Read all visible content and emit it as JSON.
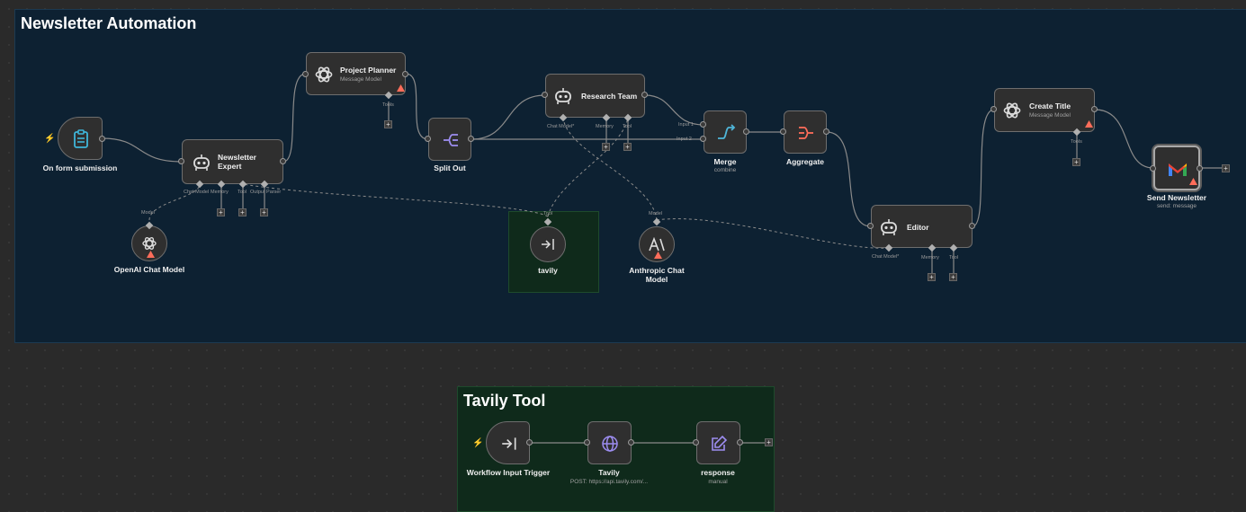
{
  "groups": {
    "newsletter": {
      "title": "Newsletter Automation"
    },
    "tavily_tool": {
      "title": "Tavily Tool"
    }
  },
  "nodes": {
    "form": {
      "label": "On form submission",
      "icon": "clipboard-icon"
    },
    "expert": {
      "label": "Newsletter Expert",
      "icon": "robot-icon"
    },
    "openai_model": {
      "label": "OpenAI Chat Model",
      "icon": "openai-icon"
    },
    "planner": {
      "label": "Project Planner",
      "subtitle": "Message Model",
      "icon": "openai-icon"
    },
    "split": {
      "label": "Split Out",
      "icon": "split-icon"
    },
    "research": {
      "label": "Research Team",
      "icon": "robot-icon"
    },
    "tavily_call": {
      "label": "tavily",
      "icon": "workflow-tool-icon"
    },
    "anthropic": {
      "label": "Anthropic Chat Model",
      "icon": "anthropic-icon"
    },
    "merge": {
      "label": "Merge",
      "subtitle": "combine",
      "icon": "merge-icon"
    },
    "aggregate": {
      "label": "Aggregate",
      "icon": "aggregate-icon"
    },
    "editor": {
      "label": "Editor",
      "icon": "robot-icon"
    },
    "create_title": {
      "label": "Create Title",
      "subtitle": "Message Model",
      "icon": "openai-icon"
    },
    "send": {
      "label": "Send Newsletter",
      "subtitle": "send: message",
      "icon": "gmail-icon"
    },
    "wf_trigger": {
      "label": "Workflow Input Trigger",
      "icon": "enter-icon"
    },
    "tavily_http": {
      "label": "Tavily",
      "subtitle": "POST: https://api.tavily.com/...",
      "icon": "globe-icon"
    },
    "response": {
      "label": "response",
      "subtitle": "manual",
      "icon": "edit-icon"
    }
  },
  "ports": {
    "expert_chat_model": "Chat Model",
    "expert_memory": "Memory",
    "expert_tool": "Tool",
    "expert_output_parser": "Output Parser",
    "openai_model": "Model",
    "planner_tools": "Tools",
    "research_chat_model": "Chat Model*",
    "research_memory": "Memory",
    "research_tool": "Tool",
    "tavily_tool": "Tool",
    "anthropic_model": "Model",
    "merge_input1": "Input 1",
    "merge_input2": "Input 2",
    "editor_chat_model": "Chat Model*",
    "editor_memory": "Memory",
    "editor_tool": "Tool",
    "title_tools": "Tools"
  },
  "plus_symbol": "+",
  "colors": {
    "canvas": "#2a2a2a",
    "group_newsletter_bg": "#0d2132",
    "group_newsletter_border": "#1c3a52",
    "group_tavily_bg": "#0f2a1b",
    "group_tavily_border": "#1e4a2c",
    "node_border": "#6e6e6e",
    "wire": "#8a8a8a",
    "trigger_bolt": "#ff6d5a",
    "warning": "#ff6d5a"
  }
}
